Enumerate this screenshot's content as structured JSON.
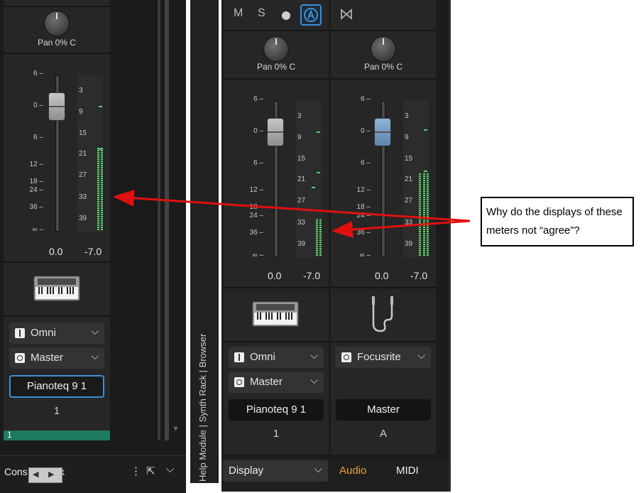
{
  "left_channel": {
    "pan_label": "Pan 0% C",
    "scale": [
      "6 –",
      "0 –",
      "6 –",
      "12 –",
      "18 –",
      "24 –",
      "36 –",
      "∞ –"
    ],
    "meter_scale": [
      "3",
      "9",
      "15",
      "21",
      "27",
      "33",
      "39"
    ],
    "fader_value": "0.0",
    "peak_value": "-7.0",
    "input": "Omni",
    "output": "Master",
    "name": "Pianoteq 9 1",
    "number": "1",
    "track_number": "1",
    "meter_level": 0.53
  },
  "divider_text": "Help Module | Synth Rack | Browser",
  "bottom_left": {
    "console_label": "Cons",
    "console_suffix": "k"
  },
  "channel_a": {
    "buttons": {
      "mute": "M",
      "solo": "S"
    },
    "pan_label": "Pan 0% C",
    "scale": [
      "6 –",
      "0 –",
      "6 –",
      "12 –",
      "18 –",
      "24 –",
      "36 –",
      "∞ –"
    ],
    "meter_scale": [
      "3",
      "9",
      "15",
      "21",
      "27",
      "33",
      "39"
    ],
    "fader_value": "0.0",
    "peak_value": "-7.0",
    "input": "Omni",
    "output": "Master",
    "name": "Pianoteq 9 1",
    "number": "1",
    "meter_level": 0.24
  },
  "channel_b": {
    "pan_label": "Pan 0% C",
    "scale": [
      "6 –",
      "0 –",
      "6 –",
      "12 –",
      "18 –",
      "24 –",
      "36 –",
      "∞ –"
    ],
    "meter_scale": [
      "3",
      "9",
      "15",
      "21",
      "27",
      "33",
      "39"
    ],
    "fader_value": "0.0",
    "peak_value": "-7.0",
    "output": "Focusrite",
    "name": "Master",
    "number": "A",
    "meter_level": 0.53
  },
  "bottom_bar": {
    "display": "Display",
    "tab_audio": "Audio",
    "tab_midi": "MIDI"
  },
  "callout": {
    "text": "Why do the displays of these meters not “agree”?"
  },
  "colors": {
    "accent_blue": "#3d8fd6",
    "meter_green": "#5fd06d",
    "audio_orange": "#e8a13a",
    "arrow_red": "#e01010"
  }
}
